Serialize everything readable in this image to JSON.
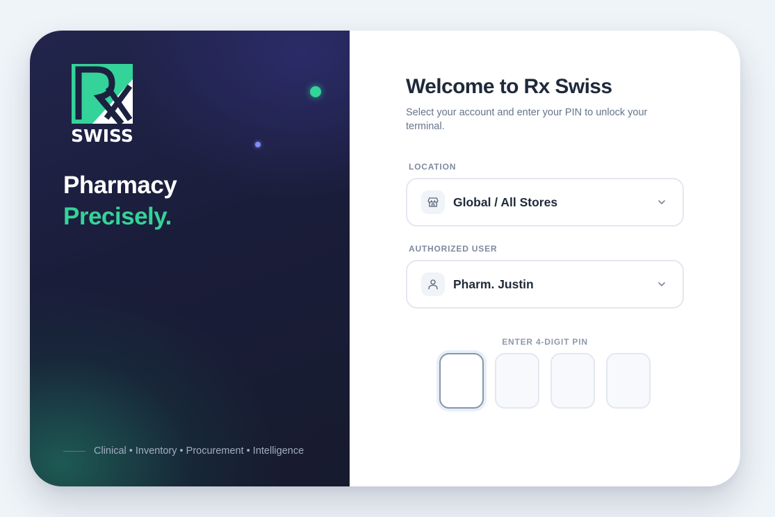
{
  "brand": {
    "logo_text": "SWISS",
    "logo_mark": "Rx",
    "tagline_line1": "Pharmacy",
    "tagline_line2": "Precisely.",
    "footer": "Clinical • Inventory • Procurement • Intelligence"
  },
  "login": {
    "title": "Welcome to Rx Swiss",
    "subtitle": "Select your account and enter your PIN to unlock your terminal.",
    "location_label": "LOCATION",
    "location_value": "Global / All Stores",
    "user_label": "AUTHORIZED USER",
    "user_value": "Pharm. Justin",
    "pin_label": "ENTER 4-DIGIT PIN",
    "pin_digits": [
      "",
      "",
      "",
      ""
    ]
  },
  "icons": {
    "location": "store-icon",
    "user": "user-icon",
    "dropdown": "chevron-down-icon"
  },
  "colors": {
    "accent": "#34d399",
    "panel_dark": "#1a1d3a",
    "heading": "#1e2a3b"
  }
}
